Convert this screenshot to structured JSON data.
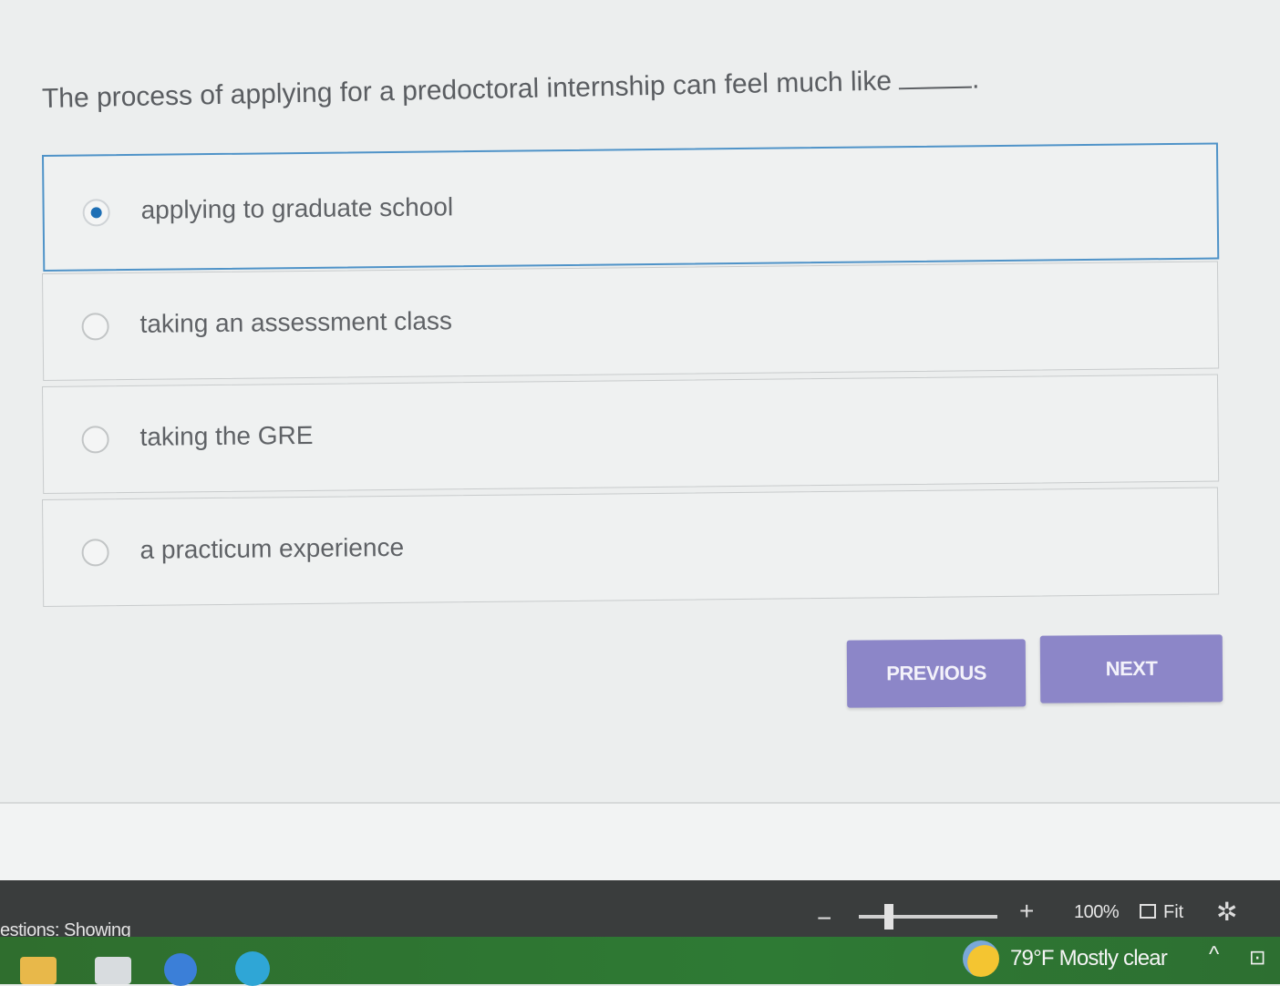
{
  "question": {
    "text": "The process of applying for a predoctoral internship can feel much like",
    "suffix": "."
  },
  "options": [
    {
      "label": "applying to graduate school",
      "selected": true
    },
    {
      "label": "taking an assessment class",
      "selected": false
    },
    {
      "label": "taking the GRE",
      "selected": false
    },
    {
      "label": "a practicum experience",
      "selected": false
    }
  ],
  "buttons": {
    "previous": "PREVIOUS",
    "next": "NEXT"
  },
  "status_bar": {
    "questions_label": "estions: Showing",
    "zoom_minus": "−",
    "zoom_plus": "+",
    "zoom_percent": "100%",
    "fit_label": "Fit",
    "brightness_icon": "brightness-icon"
  },
  "taskbar": {
    "weather": "79°F Mostly clear",
    "tray_chevron": "^"
  },
  "colors": {
    "accent": "#4f93c8",
    "button": "#8c86c8",
    "selected_dot": "#1e6fb5"
  }
}
